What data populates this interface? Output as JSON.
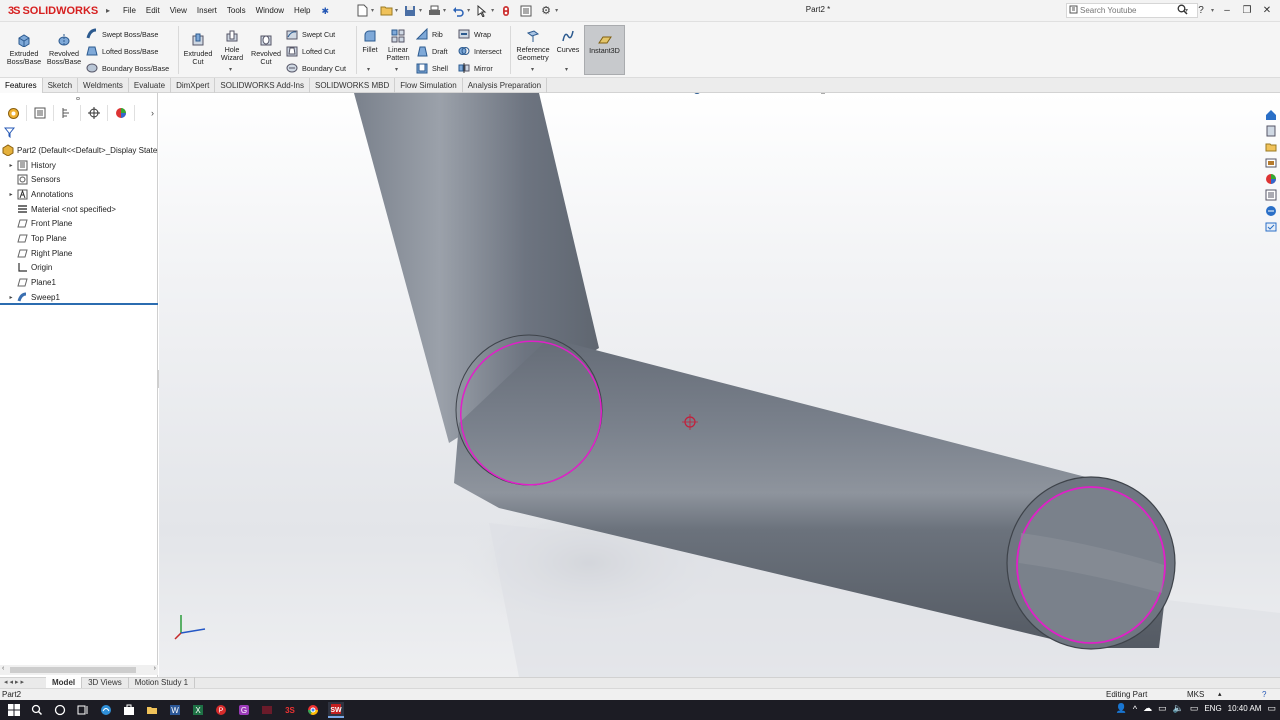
{
  "app": {
    "logo_text": "SOLIDWORKS",
    "document_title": "Part2 *",
    "menu": [
      "File",
      "Edit",
      "View",
      "Insert",
      "Tools",
      "Window",
      "Help"
    ],
    "search_placeholder": "Search Youtube"
  },
  "ribbon": {
    "extruded_boss": "Extruded Boss/Base",
    "revolved_boss": "Revolved Boss/Base",
    "swept_boss": "Swept Boss/Base",
    "lofted_boss": "Lofted Boss/Base",
    "boundary_boss": "Boundary Boss/Base",
    "extruded_cut": "Extruded Cut",
    "hole_wizard": "Hole Wizard",
    "revolved_cut": "Revolved Cut",
    "swept_cut": "Swept Cut",
    "lofted_cut": "Lofted Cut",
    "boundary_cut": "Boundary Cut",
    "fillet": "Fillet",
    "linear_pattern": "Linear Pattern",
    "rib": "Rib",
    "draft": "Draft",
    "shell": "Shell",
    "wrap": "Wrap",
    "intersect": "Intersect",
    "mirror": "Mirror",
    "reference_geometry": "Reference Geometry",
    "curves": "Curves",
    "instant3d": "Instant3D"
  },
  "command_tabs": [
    "Features",
    "Sketch",
    "Weldments",
    "Evaluate",
    "DimXpert",
    "SOLIDWORKS Add-Ins",
    "SOLIDWORKS MBD",
    "Flow Simulation",
    "Analysis Preparation"
  ],
  "feature_tree": {
    "root": "Part2  (Default<<Default>_Display State",
    "items": [
      {
        "label": "History",
        "icon": "history-icon",
        "expandable": true
      },
      {
        "label": "Sensors",
        "icon": "sensor-icon",
        "expandable": false
      },
      {
        "label": "Annotations",
        "icon": "annotation-icon",
        "expandable": true
      },
      {
        "label": "Material <not specified>",
        "icon": "material-icon",
        "expandable": false
      },
      {
        "label": "Front Plane",
        "icon": "plane-icon",
        "expandable": false
      },
      {
        "label": "Top Plane",
        "icon": "plane-icon",
        "expandable": false
      },
      {
        "label": "Right Plane",
        "icon": "plane-icon",
        "expandable": false
      },
      {
        "label": "Origin",
        "icon": "origin-icon",
        "expandable": false
      },
      {
        "label": "Plane1",
        "icon": "plane-icon",
        "expandable": false
      },
      {
        "label": "Sweep1",
        "icon": "sweep-icon",
        "expandable": true
      }
    ]
  },
  "bottom_tabs": [
    "Model",
    "3D Views",
    "Motion Study 1"
  ],
  "status": {
    "left": "Part2",
    "mode": "Editing Part",
    "units": "MKS"
  },
  "taskbar": {
    "language": "ENG",
    "time": "10:40 AM"
  },
  "colors": {
    "brand": "#d61f1f",
    "selection_edge": "#e020c8",
    "model_body": "#6f7681",
    "tree_selection_line": "#2b6cb0"
  }
}
